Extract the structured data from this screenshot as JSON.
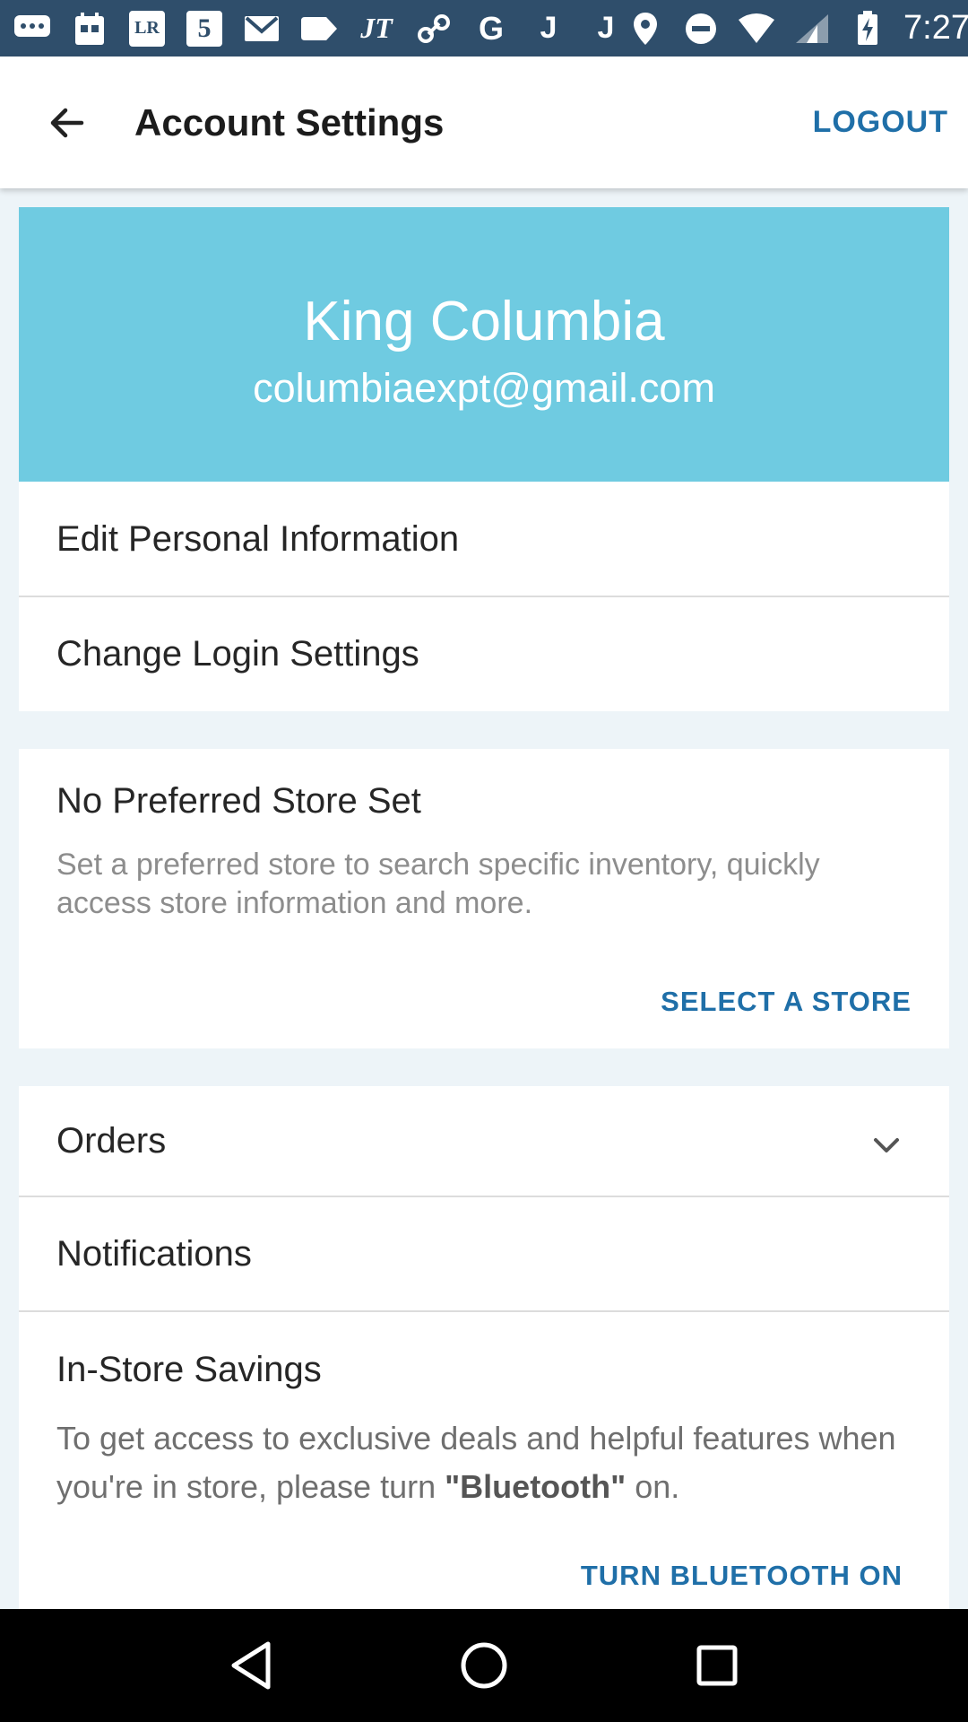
{
  "status_bar": {
    "time": "7:27",
    "icons": [
      "chat-icon",
      "calendar-icon",
      "lr-icon",
      "five-icon",
      "gmail-icon",
      "tag-icon",
      "jt-icon",
      "link-icon",
      "google-icon",
      "j-icon",
      "j-icon",
      "location-icon",
      "dnd-icon",
      "wifi-icon",
      "signal-icon",
      "battery-charging-icon"
    ],
    "lr_label": "LR",
    "five_label": "5",
    "jt_label": "JT",
    "g_label": "G",
    "j_label": "J"
  },
  "appbar": {
    "title": "Account Settings",
    "logout_label": "LOGOUT",
    "back_icon": "arrow-back-icon"
  },
  "profile": {
    "name": "King Columbia",
    "email": "columbiaexpt@gmail.com"
  },
  "account_menu": {
    "edit_personal": "Edit Personal Information",
    "change_login": "Change Login Settings"
  },
  "store": {
    "title": "No Preferred Store Set",
    "description": "Set a preferred store to search specific inventory, quickly access store information and more.",
    "select_label": "SELECT A STORE"
  },
  "menu": {
    "orders": "Orders",
    "notifications": "Notifications"
  },
  "savings": {
    "title": "In-Store Savings",
    "desc_before": "To get access to exclusive deals and helpful features when you're in store, please turn ",
    "desc_bold": "\"Bluetooth\"",
    "desc_after": " on.",
    "button_label": "TURN BLUETOOTH ON"
  },
  "colors": {
    "status_bar": "#2f4e6b",
    "header_card": "#6fcbe1",
    "accent": "#1f6fa8",
    "background": "#edf4f8"
  }
}
